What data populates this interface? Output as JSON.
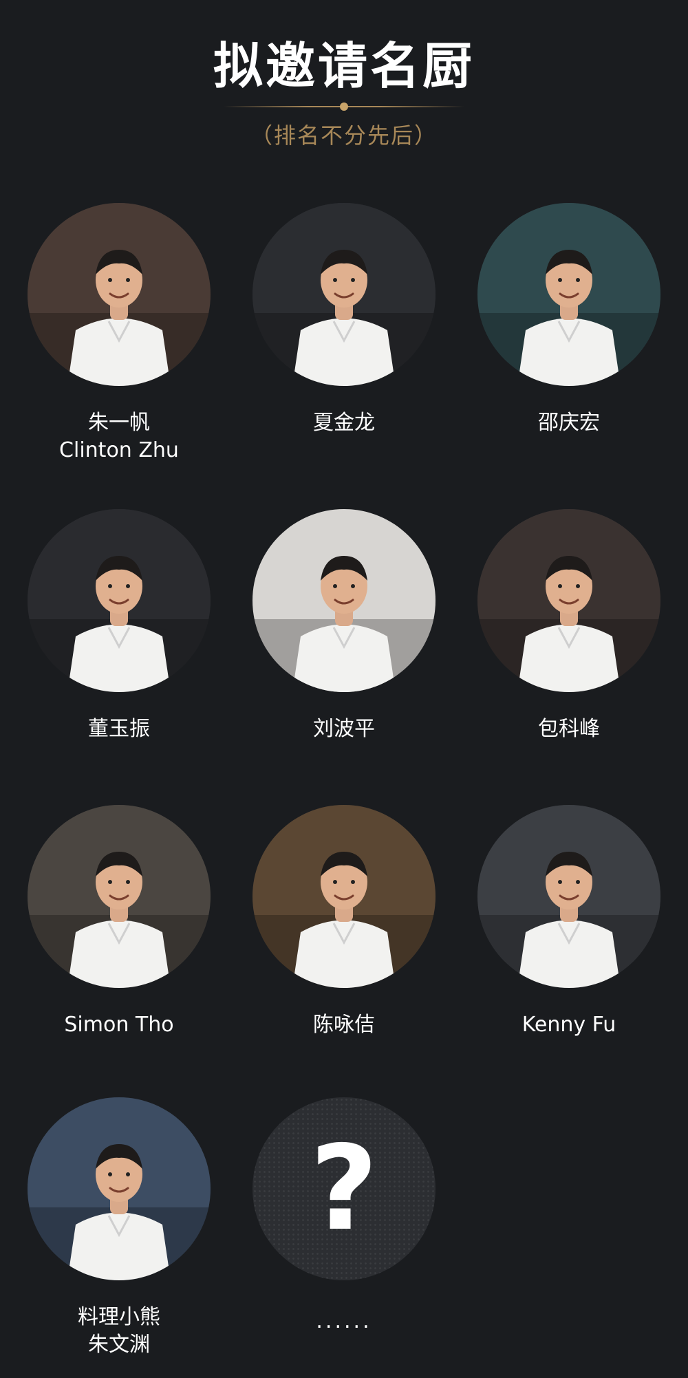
{
  "header": {
    "title": "拟邀请名厨",
    "subtitle": "（排名不分先后）"
  },
  "chefs": [
    {
      "line1": "朱一帆",
      "line2": "Clinton Zhu",
      "bg": "#4a3b35"
    },
    {
      "line1": "夏金龙",
      "line2": "",
      "bg": "#2b2d31"
    },
    {
      "line1": "邵庆宏",
      "line2": "",
      "bg": "#2f4a4e"
    },
    {
      "line1": "董玉振",
      "line2": "",
      "bg": "#2a2b2f"
    },
    {
      "line1": "刘波平",
      "line2": "",
      "bg": "#d7d5d2"
    },
    {
      "line1": "包科峰",
      "line2": "",
      "bg": "#3a3230"
    },
    {
      "line1": "Simon Tho",
      "line2": "",
      "bg": "#4b4641"
    },
    {
      "line1": "陈咏佶",
      "line2": "",
      "bg": "#5b4733"
    },
    {
      "line1": "Kenny Fu",
      "line2": "",
      "bg": "#3c3f44"
    },
    {
      "line1": "料理小熊",
      "line2": "朱文渊",
      "bg": "#3d4d63"
    }
  ],
  "mystery": {
    "symbol": "?",
    "label": "......"
  }
}
